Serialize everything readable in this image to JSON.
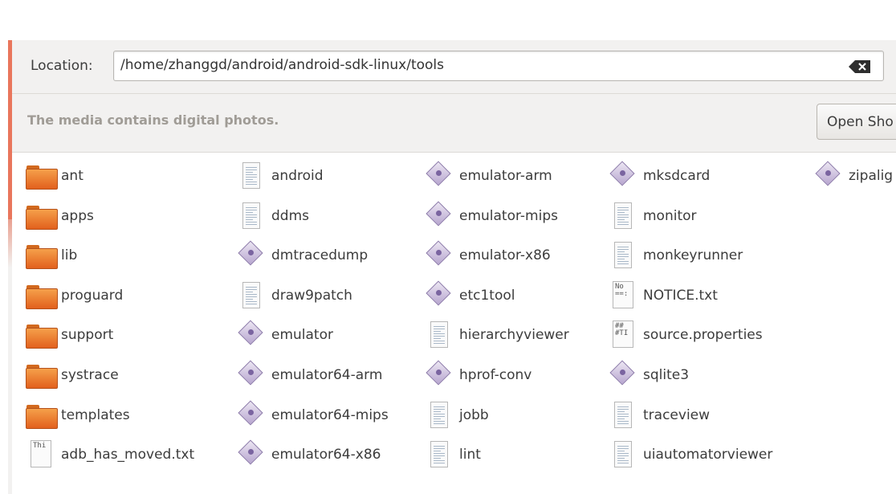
{
  "location": {
    "label": "Location:",
    "value": "/home/zhanggd/android/android-sdk-linux/tools"
  },
  "infobar": {
    "message": "The media contains digital photos.",
    "button_label": "Open Sho"
  },
  "files": [
    {
      "name": "ant",
      "kind": "folder"
    },
    {
      "name": "apps",
      "kind": "folder"
    },
    {
      "name": "lib",
      "kind": "folder"
    },
    {
      "name": "proguard",
      "kind": "folder"
    },
    {
      "name": "support",
      "kind": "folder"
    },
    {
      "name": "systrace",
      "kind": "folder"
    },
    {
      "name": "templates",
      "kind": "folder"
    },
    {
      "name": "adb_has_moved.txt",
      "kind": "text",
      "preview": "Thi"
    },
    {
      "name": "android",
      "kind": "doc"
    },
    {
      "name": "ddms",
      "kind": "doc"
    },
    {
      "name": "dmtracedump",
      "kind": "exe"
    },
    {
      "name": "draw9patch",
      "kind": "doc"
    },
    {
      "name": "emulator",
      "kind": "exe"
    },
    {
      "name": "emulator64-arm",
      "kind": "exe"
    },
    {
      "name": "emulator64-mips",
      "kind": "exe"
    },
    {
      "name": "emulator64-x86",
      "kind": "exe"
    },
    {
      "name": "emulator-arm",
      "kind": "exe"
    },
    {
      "name": "emulator-mips",
      "kind": "exe"
    },
    {
      "name": "emulator-x86",
      "kind": "exe"
    },
    {
      "name": "etc1tool",
      "kind": "exe"
    },
    {
      "name": "hierarchyviewer",
      "kind": "doc"
    },
    {
      "name": "hprof-conv",
      "kind": "exe"
    },
    {
      "name": "jobb",
      "kind": "doc"
    },
    {
      "name": "lint",
      "kind": "doc"
    },
    {
      "name": "mksdcard",
      "kind": "exe"
    },
    {
      "name": "monitor",
      "kind": "doc"
    },
    {
      "name": "monkeyrunner",
      "kind": "doc"
    },
    {
      "name": "NOTICE.txt",
      "kind": "text",
      "preview": "No\n==:"
    },
    {
      "name": "source.properties",
      "kind": "text",
      "preview": "##\n#TI"
    },
    {
      "name": "sqlite3",
      "kind": "exe"
    },
    {
      "name": "traceview",
      "kind": "doc"
    },
    {
      "name": "uiautomatorviewer",
      "kind": "doc"
    },
    {
      "name": "zipalig",
      "kind": "exe"
    }
  ]
}
